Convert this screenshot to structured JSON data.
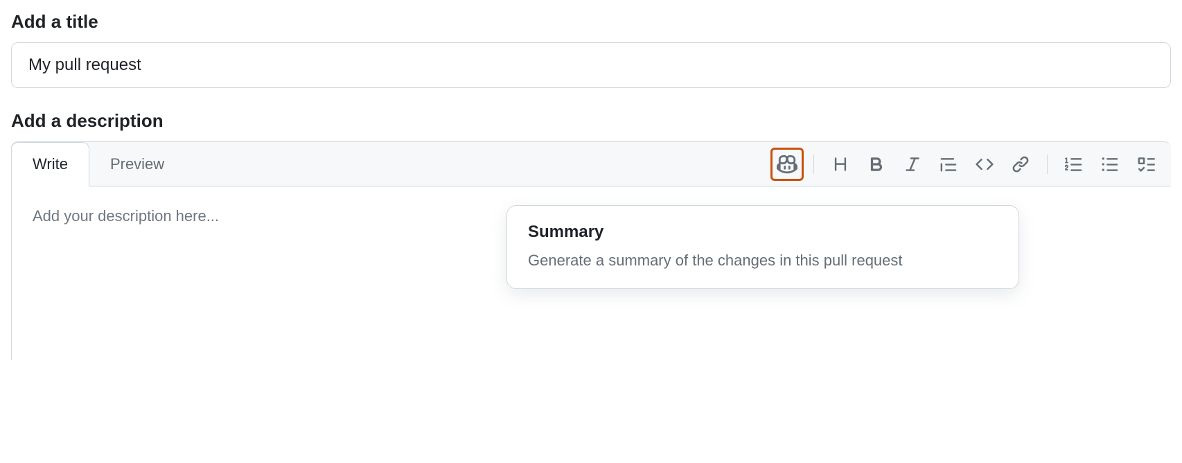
{
  "title_section": {
    "label": "Add a title",
    "value": "My pull request"
  },
  "description_section": {
    "label": "Add a description",
    "placeholder": "Add your description here..."
  },
  "tabs": {
    "write": "Write",
    "preview": "Preview"
  },
  "popup": {
    "title": "Summary",
    "description": "Generate a summary of the changes in this pull request"
  }
}
